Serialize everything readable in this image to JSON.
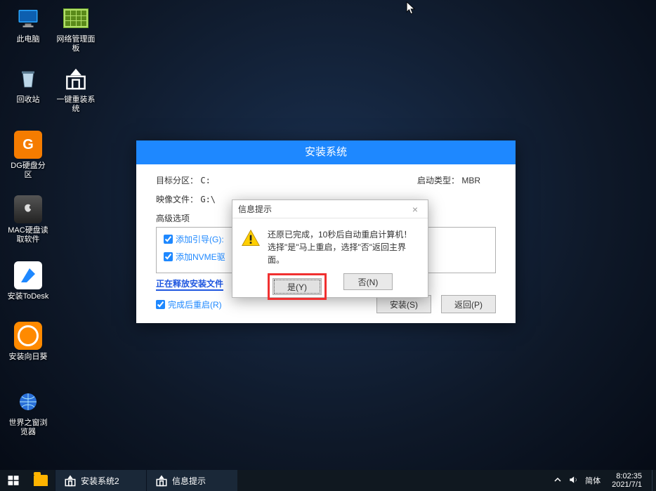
{
  "desktop": {
    "icons": [
      {
        "name": "此电脑"
      },
      {
        "name": "网络管理面板"
      },
      {
        "name": "回收站"
      },
      {
        "name": "一键重装系统"
      },
      {
        "name": "DG硬盘分区"
      },
      {
        "name": "MAC硬盘读取软件"
      },
      {
        "name": "安装ToDesk"
      },
      {
        "name": "安装向日葵"
      },
      {
        "name": "世界之窗浏览器"
      }
    ]
  },
  "install_window": {
    "title": "安装系统",
    "target_label": "目标分区：",
    "target_value": "C:",
    "boot_label": "启动类型：",
    "boot_value": "MBR",
    "image_label": "映像文件：",
    "image_value": "G:\\",
    "adv_label": "高级选项",
    "chk_boot": "添加引导(G):",
    "chk_nvme": "添加NVME驱",
    "status": "正在释放安装文件",
    "chk_reboot": "完成后重启(R)",
    "btn_install": "安装(S)",
    "btn_return": "返回(P)"
  },
  "modal": {
    "title": "信息提示",
    "line1": "还原已完成，10秒后自动重启计算机！",
    "line2": "选择\"是\"马上重启，选择\"否\"返回主界面。",
    "btn_yes": "是(Y)",
    "btn_no": "否(N)"
  },
  "taskbar": {
    "task1": "安装系统2",
    "task2": "信息提示",
    "ime": "简体",
    "time": "8:02:35",
    "date": "2021/7/1"
  }
}
